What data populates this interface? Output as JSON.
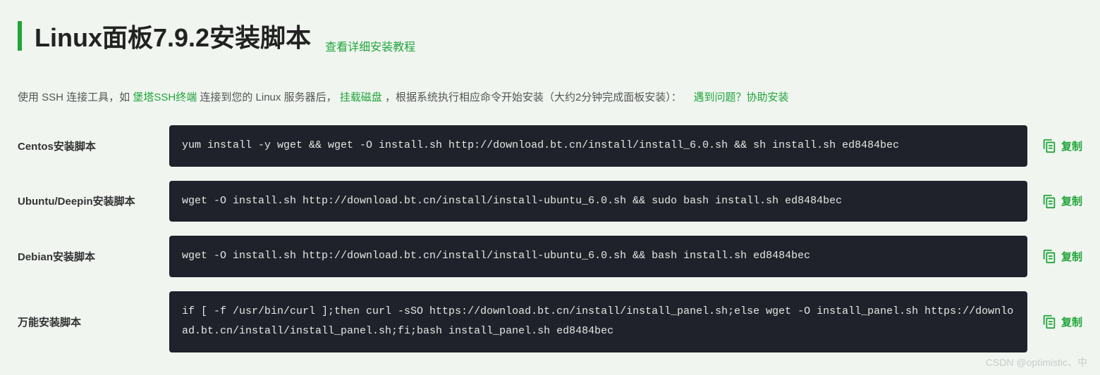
{
  "title": "Linux面板7.9.2安装脚本",
  "title_link": "查看详细安装教程",
  "desc": {
    "p1": "使用 SSH 连接工具，如 ",
    "link1": "堡塔SSH终端",
    "p2": " 连接到您的 Linux 服务器后，",
    "link2": "挂载磁盘",
    "p3": " ，根据系统执行相应命令开始安装（大约2分钟完成面板安装）：",
    "link3": "遇到问题？协助安装"
  },
  "copy_label": "复制",
  "scripts": [
    {
      "label": "Centos安装脚本",
      "code": "yum install -y wget && wget -O install.sh http://download.bt.cn/install/install_6.0.sh && sh install.sh ed8484bec"
    },
    {
      "label": "Ubuntu/Deepin安装脚本",
      "code": "wget -O install.sh http://download.bt.cn/install/install-ubuntu_6.0.sh && sudo bash install.sh ed8484bec"
    },
    {
      "label": "Debian安装脚本",
      "code": "wget -O install.sh http://download.bt.cn/install/install-ubuntu_6.0.sh && bash install.sh ed8484bec"
    },
    {
      "label": "万能安装脚本",
      "code": "if [ -f /usr/bin/curl ];then curl -sSO https://download.bt.cn/install/install_panel.sh;else wget -O install_panel.sh https://download.bt.cn/install/install_panel.sh;fi;bash install_panel.sh ed8484bec"
    }
  ],
  "watermark": "CSDN @optimistic、中"
}
